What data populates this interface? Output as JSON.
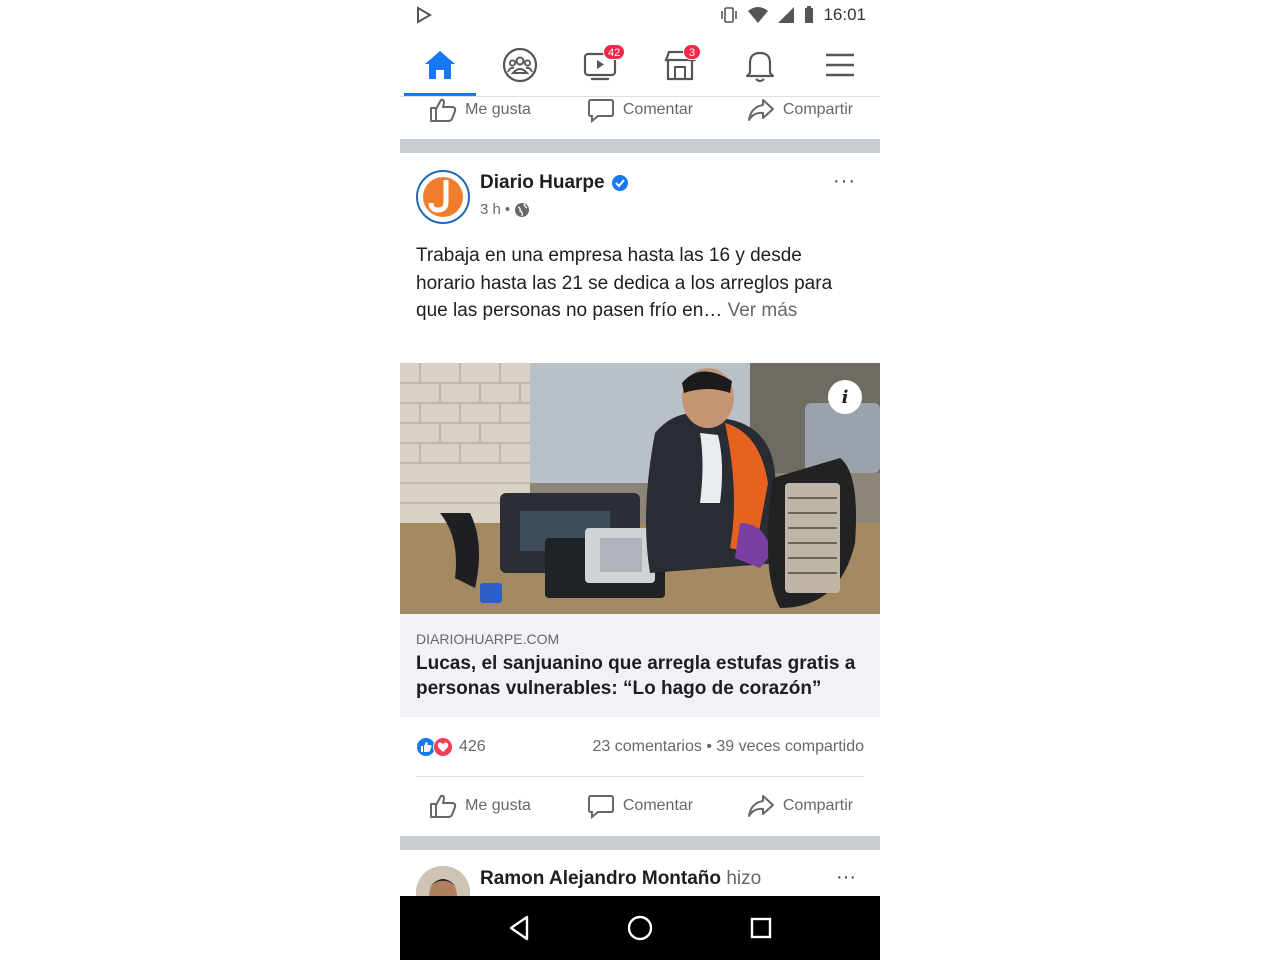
{
  "status_bar": {
    "time": "16:01"
  },
  "nav": {
    "tabs": [
      {
        "name": "home",
        "badge": ""
      },
      {
        "name": "groups",
        "badge": ""
      },
      {
        "name": "watch",
        "badge": "42"
      },
      {
        "name": "marketplace",
        "badge": "3"
      },
      {
        "name": "notifications",
        "badge": ""
      },
      {
        "name": "menu",
        "badge": ""
      }
    ]
  },
  "actions": {
    "like": "Me gusta",
    "comment": "Comentar",
    "share": "Compartir"
  },
  "post": {
    "page_name": "Diario Huarpe",
    "time": "3 h",
    "text": "Trabaja en una empresa hasta las 16 y desde horario hasta las 21 se dedica a los arreglos para que las personas no pasen frío en… ",
    "see_more": "Ver más",
    "link_domain": "DIARIOHUARPE.COM",
    "link_title": "Lucas, el sanjuanino que arregla estufas gratis a personas vulnerables: “Lo hago de corazón”",
    "reaction_count": "426",
    "comments_shares": "23 comentarios • 39 veces compartido",
    "more_icon": "···"
  },
  "next_post": {
    "author": "Ramon Alejandro Montaño",
    "verb": "hizo"
  },
  "colors": {
    "accent": "#1877f2",
    "badge": "#f02849",
    "love": "#f33e58"
  }
}
